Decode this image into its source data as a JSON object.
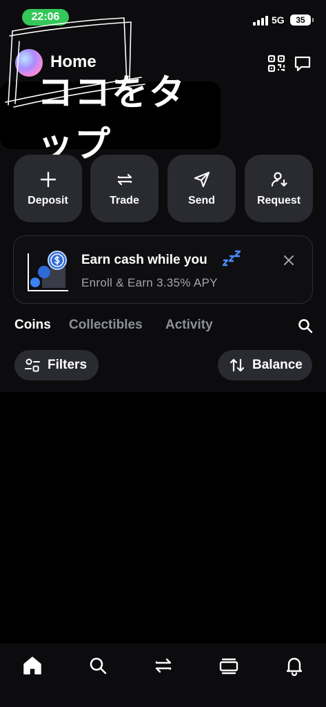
{
  "status_bar": {
    "time": "22:06",
    "network": "5G",
    "battery": "35"
  },
  "header": {
    "title": "Home"
  },
  "annotation": {
    "text": "ココをタップ"
  },
  "actions": [
    {
      "label": "Deposit",
      "icon": "plus-icon"
    },
    {
      "label": "Trade",
      "icon": "swap-icon"
    },
    {
      "label": "Send",
      "icon": "send-icon"
    },
    {
      "label": "Request",
      "icon": "request-icon"
    }
  ],
  "earn_card": {
    "title": "Earn cash while you",
    "subtitle": "Enroll & Earn 3.35% APY"
  },
  "tabs": [
    {
      "label": "Coins",
      "active": true
    },
    {
      "label": "Collectibles",
      "active": false
    },
    {
      "label": "Activity",
      "active": false
    }
  ],
  "filters": {
    "filters_label": "Filters",
    "sort_label": "Balance"
  },
  "bottom_nav": [
    "home-icon",
    "search-icon",
    "swap-icon",
    "collectibles-icon",
    "notifications-icon"
  ],
  "colors": {
    "background": "#0c0c0e",
    "surface": "#2a2b30",
    "accent": "#3b82f6",
    "time_pill": "#34c759"
  }
}
